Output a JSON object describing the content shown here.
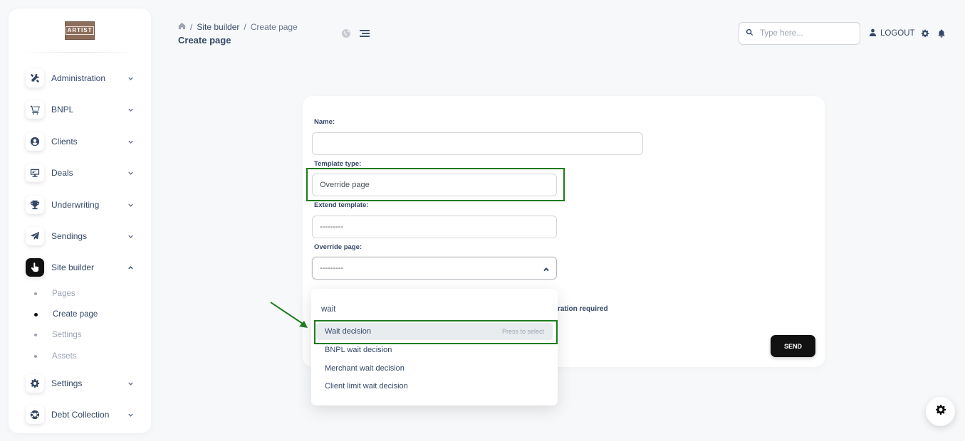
{
  "app": {
    "logo_text": "ARTIST"
  },
  "sidebar": {
    "items": [
      {
        "label": "Administration",
        "icon": "tools-icon"
      },
      {
        "label": "BNPL",
        "icon": "cart-icon"
      },
      {
        "label": "Clients",
        "icon": "user-circle-icon"
      },
      {
        "label": "Deals",
        "icon": "monitor-icon"
      },
      {
        "label": "Underwriting",
        "icon": "trophy-icon"
      },
      {
        "label": "Sendings",
        "icon": "paper-plane-icon"
      },
      {
        "label": "Site builder",
        "icon": "pointer-hand-icon",
        "expanded": true
      },
      {
        "label": "Settings",
        "icon": "gear-icon"
      },
      {
        "label": "Debt Collection",
        "icon": "lifebuoy-icon"
      }
    ],
    "site_builder_sub": [
      {
        "label": "Pages"
      },
      {
        "label": "Create page",
        "active": true
      },
      {
        "label": "Settings"
      },
      {
        "label": "Assets"
      }
    ]
  },
  "header": {
    "breadcrumb": [
      "Site builder",
      "Create page"
    ],
    "title": "Create page",
    "search_placeholder": "Type here...",
    "logout_label": "LOGOUT"
  },
  "form": {
    "name_label": "Name:",
    "name_value": "",
    "template_type_label": "Template type:",
    "template_type_value": "Override page",
    "extend_template_label": "Extend template:",
    "extend_template_value": "---------",
    "override_page_label": "Override page:",
    "override_page_value": "---------",
    "partial_text": "ration required",
    "send_label": "SEND"
  },
  "dropdown": {
    "search_value": "wait",
    "select_hint": "Press to select",
    "options": [
      "Wait decision",
      "BNPL wait decision",
      "Merchant wait decision",
      "Client limit wait decision"
    ]
  },
  "colors": {
    "highlight": "#1f7a1f",
    "arrow": "#1f7a1f",
    "active_icon_bg": "#111111"
  }
}
